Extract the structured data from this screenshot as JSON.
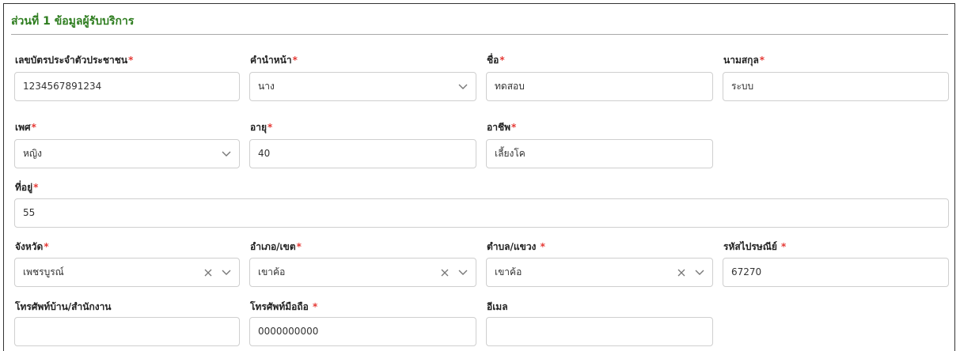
{
  "section": {
    "title": "ส่วนที่ 1 ข้อมูลผู้รับบริการ"
  },
  "required_mark": "*",
  "fields": {
    "id_card": {
      "label": "เลขบัตรประจำตัวประชาชน",
      "value": "1234567891234",
      "required": true
    },
    "prefix": {
      "label": "คำนำหน้า",
      "value": "นาง",
      "required": true
    },
    "first_name": {
      "label": "ชื่อ",
      "value": "ทดสอบ",
      "required": true
    },
    "last_name": {
      "label": "นามสกุล",
      "value": "ระบบ",
      "required": true
    },
    "gender": {
      "label": "เพศ",
      "value": "หญิง",
      "required": true
    },
    "age": {
      "label": "อายุ",
      "value": "40",
      "required": true
    },
    "occupation": {
      "label": "อาชีพ",
      "value": "เลี้ยงโค",
      "required": true
    },
    "address": {
      "label": "ที่อยู่",
      "value": "55",
      "required": true
    },
    "province": {
      "label": "จังหวัด",
      "value": "เพชรบูรณ์",
      "required": true
    },
    "district": {
      "label": "อำเภอ/เขต",
      "value": "เขาค้อ",
      "required": true
    },
    "subdistrict": {
      "label": "ตำบล/แขวง ",
      "value": "เขาค้อ",
      "required": true
    },
    "postcode": {
      "label": "รหัสไปรษณีย์ ",
      "value": "67270",
      "required": true
    },
    "home_phone": {
      "label": "โทรศัพท์บ้าน/สำนักงาน",
      "value": "",
      "required": false
    },
    "mobile": {
      "label": "โทรศัพท์มือถือ ",
      "value": "0000000000",
      "required": true
    },
    "email": {
      "label": "อีเมล",
      "value": "",
      "required": false
    }
  },
  "colors": {
    "title_green": "#2e7d1f",
    "required_red": "#e53935",
    "border": "#cfcfcf"
  },
  "icons": {
    "clear": "close-icon",
    "dropdown": "chevron-down-icon"
  }
}
